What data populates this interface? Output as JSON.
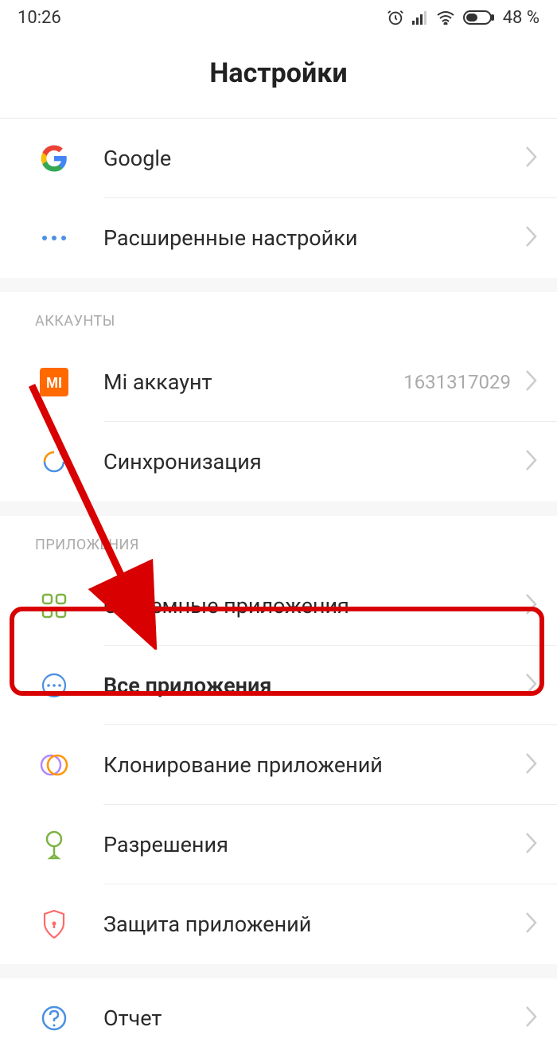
{
  "status": {
    "time": "10:26",
    "battery": "48 %"
  },
  "header": {
    "title": "Настройки"
  },
  "items": {
    "google": {
      "label": "Google"
    },
    "advanced": {
      "label": "Расширенные настройки"
    },
    "mi_account": {
      "label": "Mi аккаунт",
      "value": "1631317029"
    },
    "sync": {
      "label": "Синхронизация"
    },
    "system_apps": {
      "label": "Системные приложения"
    },
    "all_apps": {
      "label": "Все приложения"
    },
    "clone_apps": {
      "label": "Клонирование приложений"
    },
    "permissions": {
      "label": "Разрешения"
    },
    "app_lock": {
      "label": "Защита приложений"
    },
    "report": {
      "label": "Отчет"
    }
  },
  "sections": {
    "accounts": "АККАУНТЫ",
    "apps": "ПРИЛОЖЕНИЯ"
  }
}
